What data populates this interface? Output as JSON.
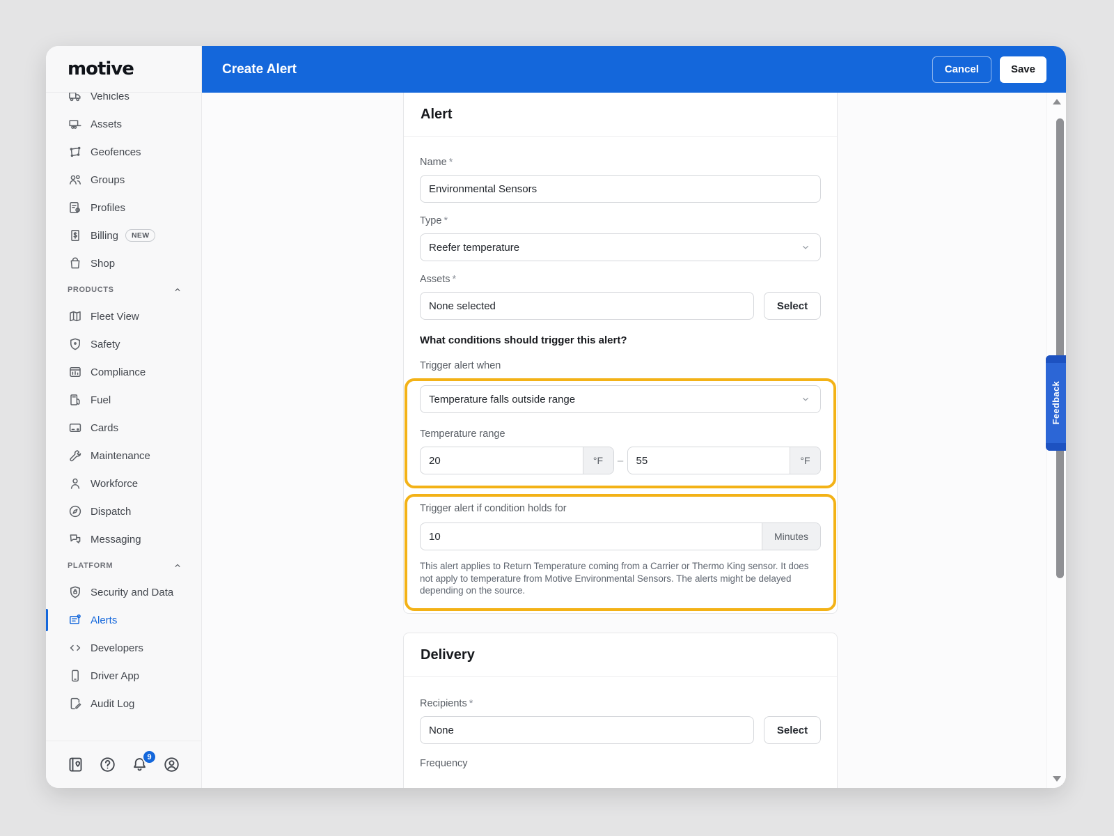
{
  "colors": {
    "header_blue": "#1467db",
    "active_blue": "#1467db",
    "highlight_yellow": "#f3b217",
    "badge_blue": "#1467db",
    "backdrop_gray": "#e4e4e5"
  },
  "sidebar": {
    "logo_text": "motive",
    "sections": [
      {
        "header": null,
        "items": [
          {
            "id": "vehicles",
            "label": "Vehicles",
            "icon": "truck-icon"
          },
          {
            "id": "assets",
            "label": "Assets",
            "icon": "trailer-icon"
          },
          {
            "id": "geofences",
            "label": "Geofences",
            "icon": "geofence-icon"
          },
          {
            "id": "groups",
            "label": "Groups",
            "icon": "groups-icon"
          },
          {
            "id": "profiles",
            "label": "Profiles",
            "icon": "profiles-icon"
          },
          {
            "id": "billing",
            "label": "Billing",
            "icon": "billing-icon",
            "badge": "NEW"
          },
          {
            "id": "shop",
            "label": "Shop",
            "icon": "shopping-bag-icon"
          }
        ]
      },
      {
        "header": "PRODUCTS",
        "items": [
          {
            "id": "fleet-view",
            "label": "Fleet View",
            "icon": "map-icon"
          },
          {
            "id": "safety",
            "label": "Safety",
            "icon": "shield-icon"
          },
          {
            "id": "compliance",
            "label": "Compliance",
            "icon": "compliance-icon"
          },
          {
            "id": "fuel",
            "label": "Fuel",
            "icon": "fuel-pump-icon"
          },
          {
            "id": "cards",
            "label": "Cards",
            "icon": "credit-card-icon"
          },
          {
            "id": "maintenance",
            "label": "Maintenance",
            "icon": "wrench-icon"
          },
          {
            "id": "workforce",
            "label": "Workforce",
            "icon": "person-icon"
          },
          {
            "id": "dispatch",
            "label": "Dispatch",
            "icon": "compass-icon"
          },
          {
            "id": "messaging",
            "label": "Messaging",
            "icon": "chat-bubbles-icon"
          }
        ]
      },
      {
        "header": "PLATFORM",
        "items": [
          {
            "id": "security-and-data",
            "label": "Security and Data",
            "icon": "shield-lock-icon"
          },
          {
            "id": "alerts",
            "label": "Alerts",
            "icon": "alert-note-icon",
            "active": true
          },
          {
            "id": "developers",
            "label": "Developers",
            "icon": "code-icon"
          },
          {
            "id": "driver-app",
            "label": "Driver App",
            "icon": "phone-icon"
          },
          {
            "id": "audit-log",
            "label": "Audit Log",
            "icon": "audit-log-icon"
          }
        ]
      }
    ],
    "footer_icons": [
      {
        "id": "resources",
        "icon": "address-book-icon"
      },
      {
        "id": "help",
        "icon": "help-circle-icon"
      },
      {
        "id": "notifications",
        "icon": "bell-icon",
        "badge": "9"
      },
      {
        "id": "account",
        "icon": "account-icon"
      }
    ]
  },
  "header": {
    "title": "Create Alert",
    "cancel_label": "Cancel",
    "save_label": "Save"
  },
  "form": {
    "required_marker": "*",
    "alert_card": {
      "title": "Alert",
      "name_label": "Name",
      "name_value": "Environmental Sensors",
      "type_label": "Type",
      "type_value": "Reefer temperature",
      "assets_label": "Assets",
      "assets_value": "None selected",
      "assets_select_label": "Select",
      "conditions_question": "What conditions should trigger this alert?",
      "trigger_when_label": "Trigger alert when",
      "trigger_when_value": "Temperature falls outside range",
      "temp_range_label": "Temperature range",
      "temp_min": "20",
      "temp_max": "55",
      "temp_unit": "°F",
      "range_separator": "–",
      "holds_for_label": "Trigger alert if condition holds for",
      "holds_for_value": "10",
      "holds_for_unit": "Minutes",
      "help_text": "This alert applies to Return Temperature coming from a Carrier or Thermo King sensor. It does not apply to temperature from Motive Environmental Sensors. The alerts might be delayed depending on the source."
    },
    "delivery_card": {
      "title": "Delivery",
      "recipients_label": "Recipients",
      "recipients_value": "None",
      "recipients_select_label": "Select",
      "frequency_label": "Frequency"
    }
  },
  "feedback_tab": {
    "label": "Feedback"
  }
}
